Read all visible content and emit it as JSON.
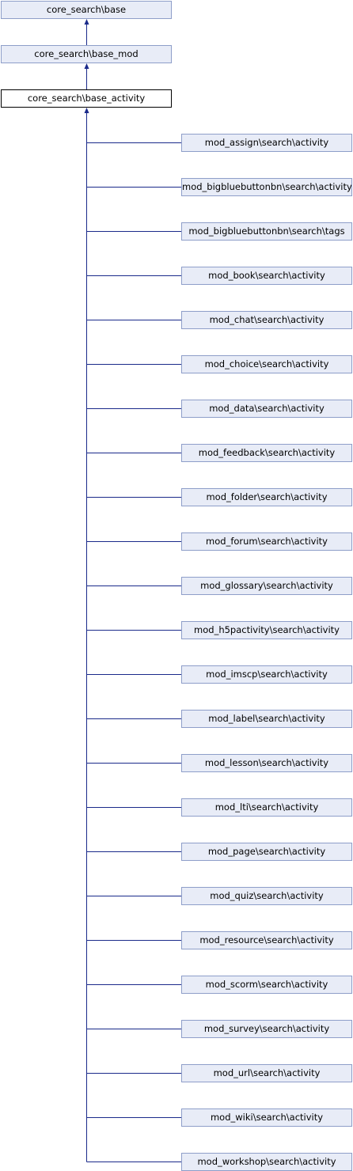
{
  "colors": {
    "node_fill": "#e8ecf7",
    "node_border": "#8e9ec9",
    "current_fill": "#ffffff",
    "current_border": "#000000",
    "edge": "#1a2a8a"
  },
  "diagram": {
    "root": "core_search\\base",
    "parent": "core_search\\base_mod",
    "current": "core_search\\base_activity",
    "children": [
      "mod_assign\\search\\activity",
      "mod_bigbluebuttonbn\\search\\activity",
      "mod_bigbluebuttonbn\\search\\tags",
      "mod_book\\search\\activity",
      "mod_chat\\search\\activity",
      "mod_choice\\search\\activity",
      "mod_data\\search\\activity",
      "mod_feedback\\search\\activity",
      "mod_folder\\search\\activity",
      "mod_forum\\search\\activity",
      "mod_glossary\\search\\activity",
      "mod_h5pactivity\\search\\activity",
      "mod_imscp\\search\\activity",
      "mod_label\\search\\activity",
      "mod_lesson\\search\\activity",
      "mod_lti\\search\\activity",
      "mod_page\\search\\activity",
      "mod_quiz\\search\\activity",
      "mod_resource\\search\\activity",
      "mod_scorm\\search\\activity",
      "mod_survey\\search\\activity",
      "mod_url\\search\\activity",
      "mod_wiki\\search\\activity",
      "mod_workshop\\search\\activity"
    ]
  }
}
